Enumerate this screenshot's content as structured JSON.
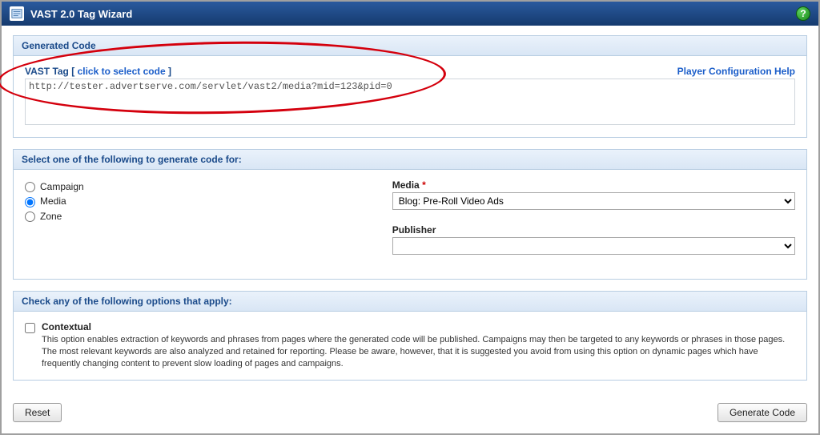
{
  "title": "VAST 2.0 Tag Wizard",
  "help_icon": "?",
  "generated": {
    "header": "Generated Code",
    "tag_label_prefix": "VAST Tag [ ",
    "tag_label_link": "click to select code",
    "tag_label_suffix": " ]",
    "help_link": "Player Configuration Help",
    "code": "http://tester.advertserve.com/servlet/vast2/media?mid=123&pid=0"
  },
  "select_section": {
    "header": "Select one of the following to generate code for:",
    "options": [
      {
        "label": "Campaign",
        "checked": false
      },
      {
        "label": "Media",
        "checked": true
      },
      {
        "label": "Zone",
        "checked": false
      }
    ],
    "media_label": "Media",
    "media_req": "*",
    "media_value": "Blog: Pre-Roll Video Ads",
    "publisher_label": "Publisher",
    "publisher_value": ""
  },
  "options_section": {
    "header": "Check any of the following options that apply:",
    "contextual_title": "Contextual",
    "contextual_desc": "This option enables extraction of keywords and phrases from pages where the generated code will be published. Campaigns may then be targeted to any keywords or phrases in those pages. The most relevant keywords are also analyzed and retained for reporting. Please be aware, however, that it is suggested you avoid from using this option on dynamic pages which have frequently changing content to prevent slow loading of pages and campaigns."
  },
  "buttons": {
    "reset": "Reset",
    "generate": "Generate Code"
  }
}
